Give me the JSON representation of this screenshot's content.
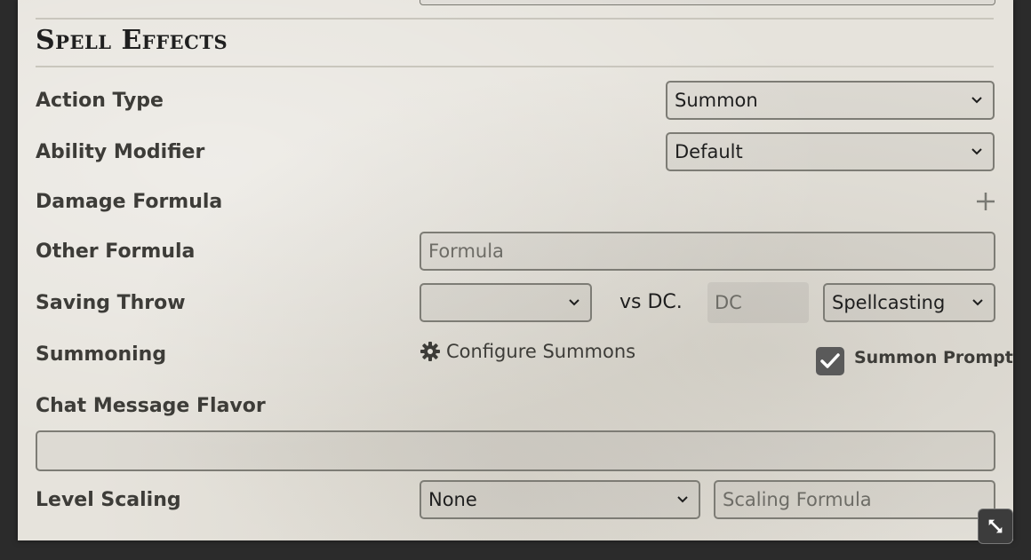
{
  "section": {
    "title": "Spell Effects"
  },
  "fields": {
    "action_type": {
      "label": "Action Type",
      "value": "Summon"
    },
    "ability_modifier": {
      "label": "Ability Modifier",
      "value": "Default"
    },
    "damage_formula": {
      "label": "Damage Formula",
      "add_icon": "plus-icon"
    },
    "other_formula": {
      "label": "Other Formula",
      "placeholder": "Formula"
    },
    "saving_throw": {
      "label": "Saving Throw",
      "ability_value": "",
      "vs_text": "vs DC.",
      "dc_placeholder": "DC",
      "dc_mode_value": "Spellcasting"
    },
    "summoning": {
      "label": "Summoning",
      "configure_label": "Configure Summons",
      "configure_icon": "gear-icon",
      "prompt_label": "Summon Prompt",
      "prompt_checked": true
    },
    "chat_flavor": {
      "label": "Chat Message Flavor",
      "value": ""
    },
    "level_scaling": {
      "label": "Level Scaling",
      "mode_value": "None",
      "formula_placeholder": "Scaling Formula"
    }
  },
  "window": {
    "resize_icon": "resize-handle-icon"
  }
}
